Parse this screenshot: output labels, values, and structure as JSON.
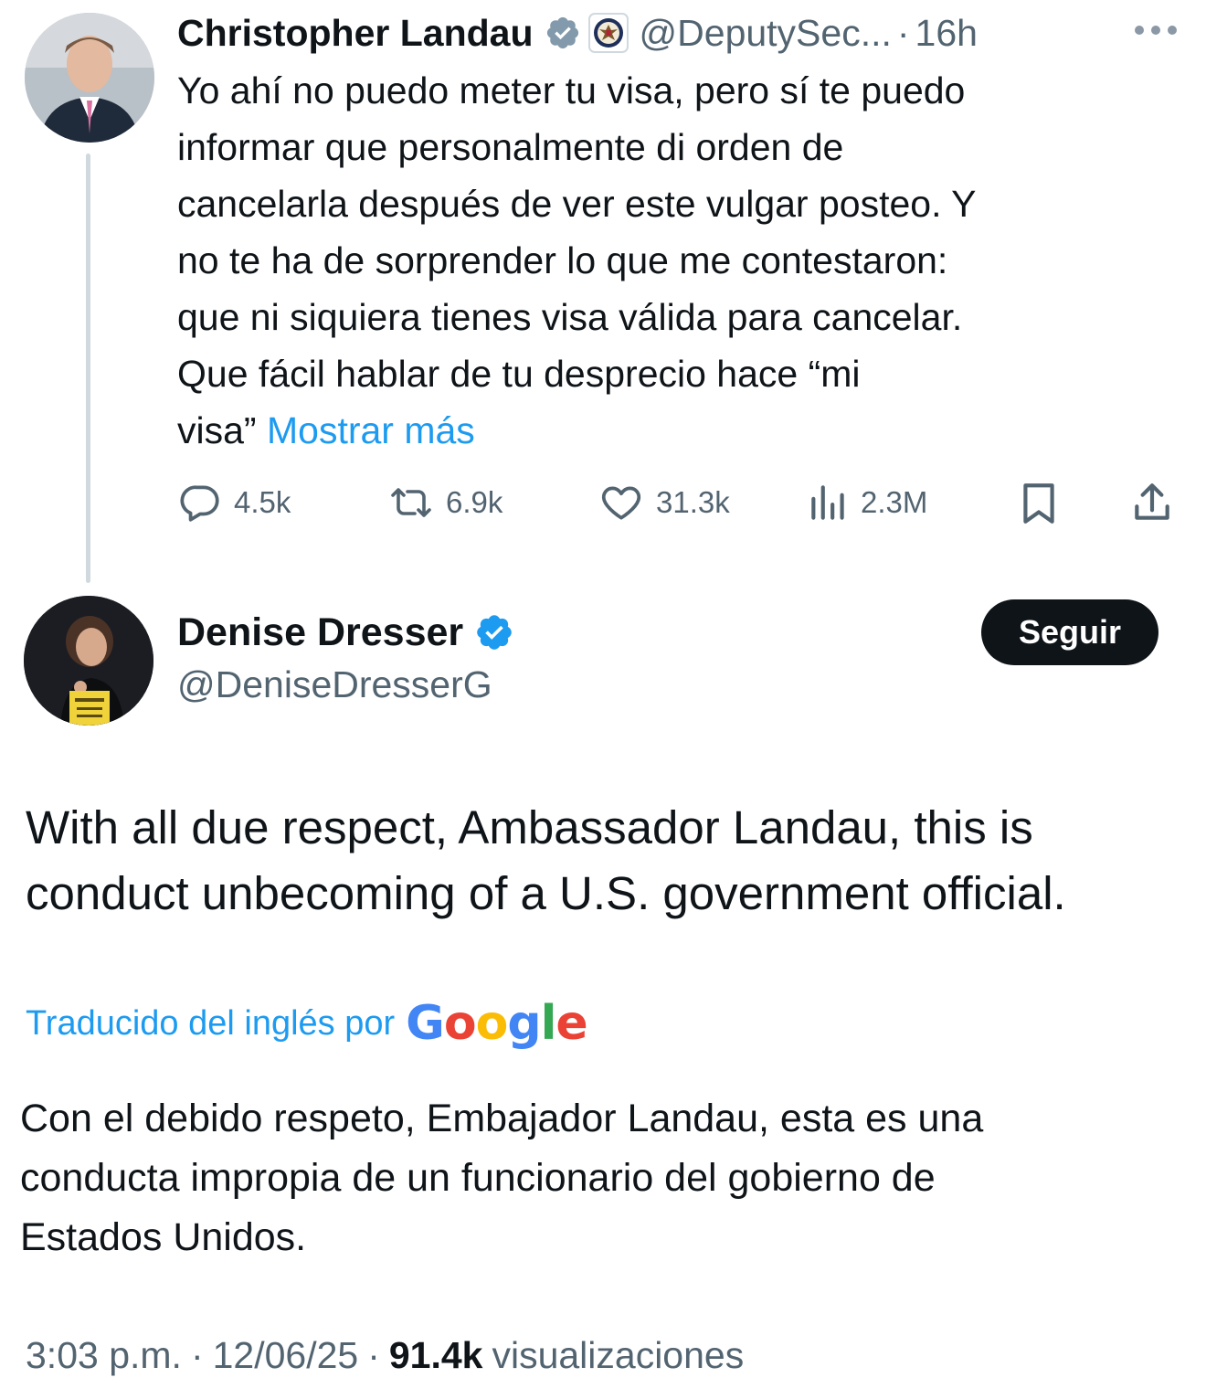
{
  "parent_tweet": {
    "author_name": "Christopher Landau",
    "handle": "@DeputySec...",
    "separator": "·",
    "time": "16h",
    "text_lines": [
      "Yo ahí no puedo meter tu visa, pero sí te puedo",
      "informar que personalmente di orden de",
      "cancelarla después de ver este vulgar posteo. Y",
      "no te ha de sorprender lo que me contestaron:",
      "que ni siquiera tienes visa válida para cancelar.",
      "Que fácil hablar de tu desprecio hace “mi",
      "visa”"
    ],
    "show_more": "Mostrar más",
    "stats": {
      "replies": "4.5k",
      "reposts": "6.9k",
      "likes": "31.3k",
      "views": "2.3M"
    }
  },
  "main_tweet": {
    "author_name": "Denise Dresser",
    "handle": "@DeniseDresserG",
    "follow_label": "Seguir",
    "text_lines": [
      "With all due respect, Ambassador Landau, this is",
      "conduct unbecoming of a U.S. government official."
    ],
    "translated_label": "Traducido del inglés por",
    "google_letters": [
      "G",
      "o",
      "o",
      "g",
      "l",
      "e"
    ],
    "translated_lines": [
      "Con el debido respeto, Embajador Landau, esta es una",
      "conducta impropia de un funcionario del gobierno de",
      "Estados Unidos."
    ],
    "meta": {
      "time": "3:03 p.m.",
      "separator": "·",
      "date": "12/06/25",
      "views_count": "91.4k",
      "views_label": "visualizaciones"
    }
  },
  "colors": {
    "text": "#0f1419",
    "secondary": "#536471",
    "link": "#1d9bf0",
    "verified_blue": "#1d9bf0",
    "verified_gray": "#829aab",
    "follow_bg": "#0f1419"
  },
  "icons": {
    "reply": "reply-icon",
    "repost": "repost-icon",
    "like": "heart-icon",
    "views": "analytics-icon",
    "bookmark": "bookmark-icon",
    "share": "share-icon",
    "more": "more-icon",
    "seal": "state-department-seal-icon"
  }
}
